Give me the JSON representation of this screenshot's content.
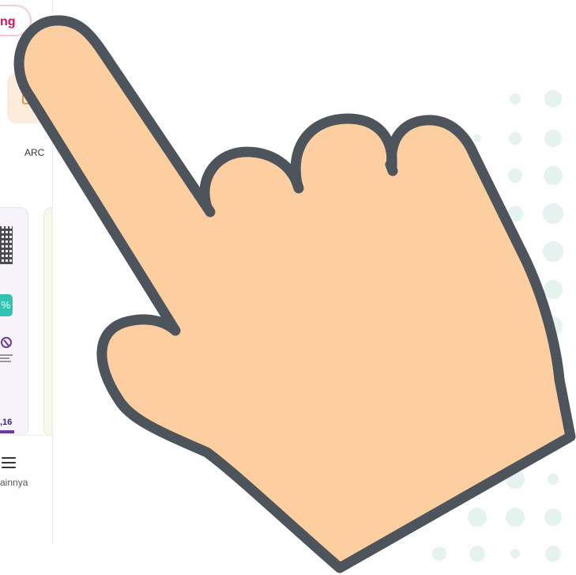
{
  "app": {
    "pill_text": "ng",
    "tile_label": "ARC",
    "badge_text": "%",
    "value_text": ",16",
    "nav_label": "ainnya"
  },
  "colors": {
    "hand_fill": "#FDCFA0",
    "hand_outline": "#4E545C",
    "dot_color": "#E3F1EE",
    "pill_text": "#D4145A",
    "badge": "#2FC4B2",
    "accent_purple": "#6A3AA8"
  },
  "icons": [
    "hamburger-menu-icon",
    "qr-code-icon",
    "pointing-hand-icon",
    "category-icon"
  ]
}
